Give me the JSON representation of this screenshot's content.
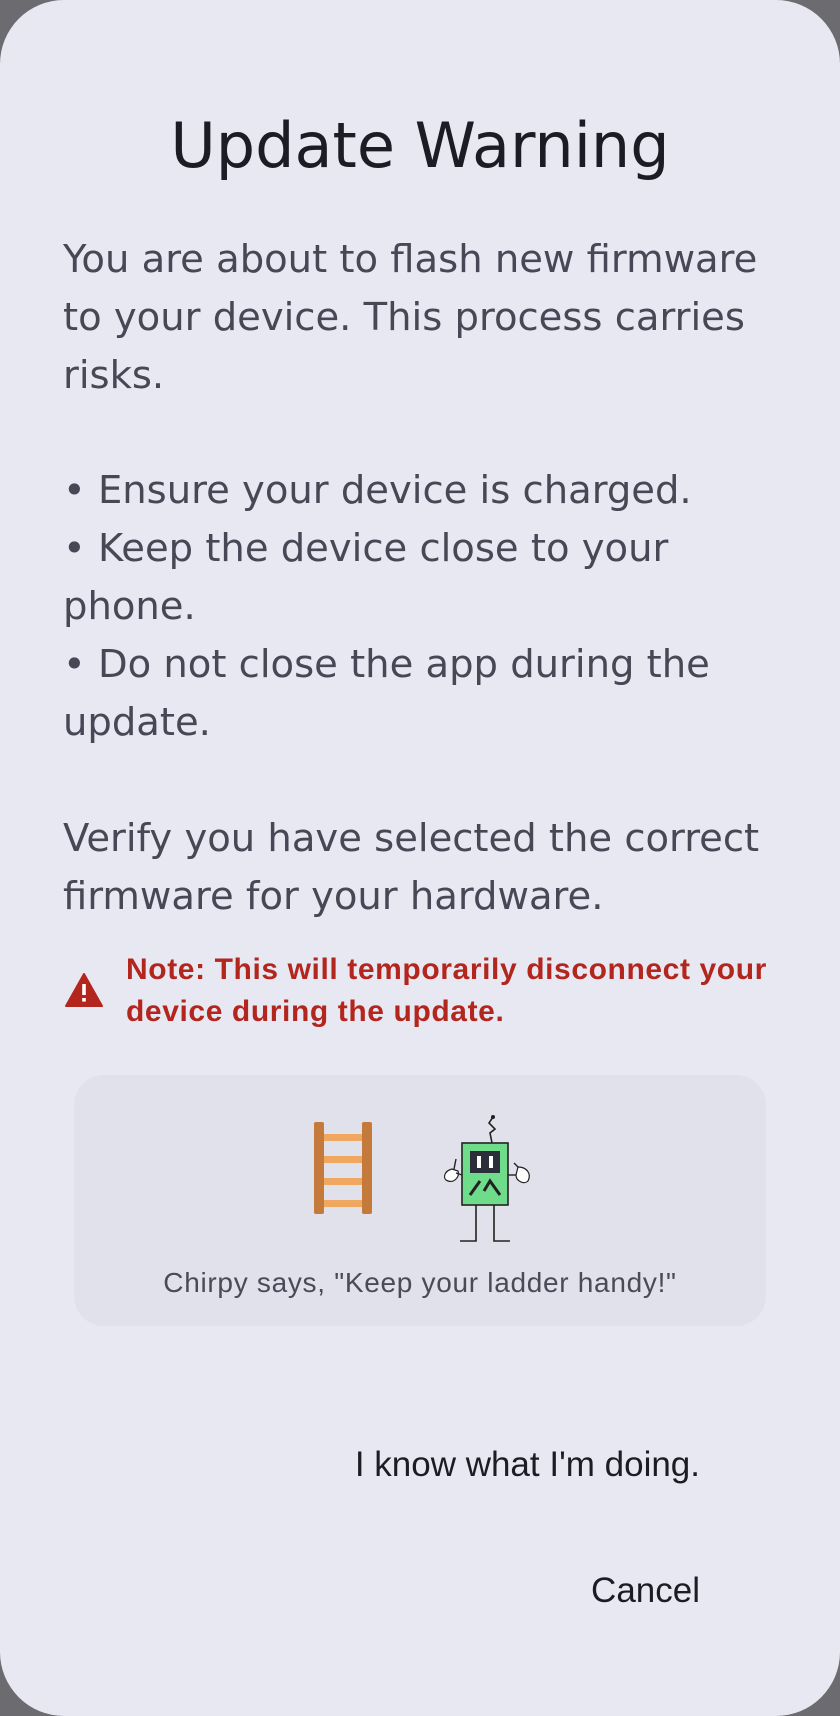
{
  "dialog": {
    "title": "Update Warning",
    "intro": "You are about to flash new firmware to your device. This process carries risks.",
    "bullets": [
      "• Ensure your device is charged.",
      "• Keep the device close to your phone.",
      "• Do not close the app during the update."
    ],
    "verify": "Verify you have selected the correct firmware for your hardware.",
    "note": "Note: This will temporarily disconnect your device during the update.",
    "chirpy_caption": "Chirpy says, \"Keep your ladder handy!\"",
    "confirm_label": "I know what I'm doing.",
    "cancel_label": "Cancel"
  },
  "icons": {
    "warning": "warning-triangle-icon",
    "ladder": "ladder-icon",
    "mascot": "chirpy-robot-icon"
  },
  "colors": {
    "surface": "#e8e8f3",
    "card": "#e1e1ec",
    "error": "#b3261e",
    "text": "#474756",
    "title": "#1c1c24"
  }
}
